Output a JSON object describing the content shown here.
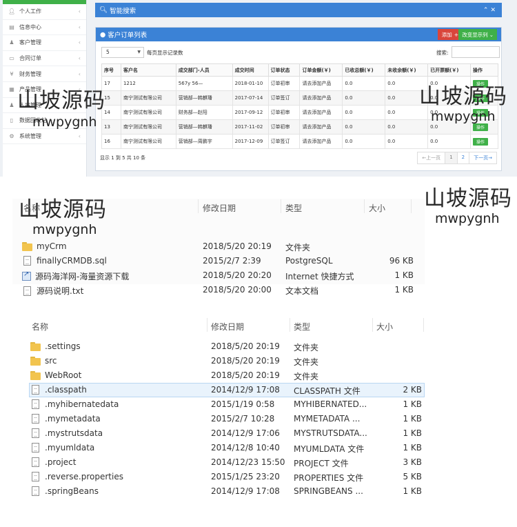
{
  "crm": {
    "sidebar_items": [
      {
        "label": "个人工作",
        "icon": "user-icon"
      },
      {
        "label": "信息中心",
        "icon": "list-icon"
      },
      {
        "label": "客户管理",
        "icon": "person-icon"
      },
      {
        "label": "合同订单",
        "icon": "document-icon"
      },
      {
        "label": "财务管理",
        "icon": "yen-icon"
      },
      {
        "label": "产品管理",
        "icon": "box-icon"
      },
      {
        "label": "人事管理",
        "icon": "people-icon"
      },
      {
        "label": "数据回收站",
        "icon": "trash-icon"
      },
      {
        "label": "系统管理",
        "icon": "gear-icon"
      }
    ],
    "search_title": "智能搜索",
    "order_title": "客户订单列表",
    "add_label": "添加",
    "toggle_cols_label": "改变显示列",
    "page_size": "5",
    "page_size_label": "每页显示记录数",
    "search_label": "搜索:",
    "columns": [
      "序号",
      "客户名",
      "成交部门-人员",
      "成交时间",
      "订单状态",
      "订单金额(￥)",
      "已收总额(￥)",
      "未收余额(￥)",
      "已开票额(￥)",
      "操作"
    ],
    "rows": [
      [
        "17",
        "1212",
        "567y 56—",
        "2018-01-10",
        "订单初审",
        "请去添加产品",
        "0.0",
        "0.0",
        "0.0",
        "操作"
      ],
      [
        "15",
        "南宁测试有限公司",
        "营销部—韩麒璠",
        "2017-07-14",
        "订单签订",
        "请去添加产品",
        "0.0",
        "0.0",
        "0.0",
        "操作"
      ],
      [
        "14",
        "南宁测试有限公司",
        "财务部—赵阳",
        "2017-09-12",
        "订单初审",
        "请去添加产品",
        "0.0",
        "0.0",
        "0.0",
        "操作"
      ],
      [
        "13",
        "南宁测试有限公司",
        "营销部—韩麒璠",
        "2017-11-02",
        "订单初审",
        "请去添加产品",
        "0.0",
        "0.0",
        "0.0",
        "操作"
      ],
      [
        "16",
        "南宁测试有限公司",
        "营销部—周鹏宇",
        "2017-12-09",
        "订单签订",
        "请去添加产品",
        "0.0",
        "0.0",
        "0.0",
        "操作"
      ]
    ],
    "paging_info": "显示 1 到 5 共 10 条",
    "pager": [
      "←上一页",
      "1",
      "2",
      "下一页→"
    ]
  },
  "explorer1": {
    "headers": {
      "name": "名称",
      "date": "修改日期",
      "type": "类型",
      "size": "大小"
    },
    "rows": [
      {
        "icon": "folder-icon",
        "name": "myCrm",
        "date": "2018/5/20 20:19",
        "type": "文件夹",
        "size": ""
      },
      {
        "icon": "file-icon",
        "name": "finallyCRMDB.sql",
        "date": "2015/2/7 2:39",
        "type": "PostgreSQL",
        "size": "96 KB"
      },
      {
        "icon": "shortcut-icon",
        "name": "源码海洋网-海量资源下载",
        "date": "2018/5/20 20:20",
        "type": "Internet 快捷方式",
        "size": "1 KB"
      },
      {
        "icon": "file-icon",
        "name": "源码说明.txt",
        "date": "2018/5/20 20:00",
        "type": "文本文档",
        "size": "1 KB"
      }
    ]
  },
  "explorer2": {
    "headers": {
      "name": "名称",
      "date": "修改日期",
      "type": "类型",
      "size": "大小"
    },
    "rows": [
      {
        "icon": "folder-icon",
        "name": ".settings",
        "date": "2018/5/20 20:19",
        "type": "文件夹",
        "size": ""
      },
      {
        "icon": "folder-icon",
        "name": "src",
        "date": "2018/5/20 20:19",
        "type": "文件夹",
        "size": ""
      },
      {
        "icon": "folder-icon",
        "name": "WebRoot",
        "date": "2018/5/20 20:19",
        "type": "文件夹",
        "size": ""
      },
      {
        "icon": "file-icon",
        "name": ".classpath",
        "date": "2014/12/9 17:08",
        "type": "CLASSPATH 文件",
        "size": "2 KB"
      },
      {
        "icon": "file-icon",
        "name": ".myhibernatedata",
        "date": "2015/1/19 0:58",
        "type": "MYHIBERNATED...",
        "size": "1 KB"
      },
      {
        "icon": "file-icon",
        "name": ".mymetadata",
        "date": "2015/2/7 10:28",
        "type": "MYMETADATA ...",
        "size": "1 KB"
      },
      {
        "icon": "file-icon",
        "name": ".mystrutsdata",
        "date": "2014/12/9 17:06",
        "type": "MYSTRUTSDATA...",
        "size": "1 KB"
      },
      {
        "icon": "file-icon",
        "name": ".myumldata",
        "date": "2014/12/8 10:40",
        "type": "MYUMLDATA 文件",
        "size": "1 KB"
      },
      {
        "icon": "file-icon",
        "name": ".project",
        "date": "2014/12/23 15:50",
        "type": "PROJECT 文件",
        "size": "3 KB"
      },
      {
        "icon": "file-icon",
        "name": ".reverse.properties",
        "date": "2015/1/25 23:20",
        "type": "PROPERTIES 文件",
        "size": "5 KB"
      },
      {
        "icon": "file-icon",
        "name": ".springBeans",
        "date": "2014/12/9 17:08",
        "type": "SPRINGBEANS ...",
        "size": "1 KB"
      }
    ]
  },
  "watermark": {
    "cn": "山坡源码",
    "en": "mwpygnh"
  }
}
